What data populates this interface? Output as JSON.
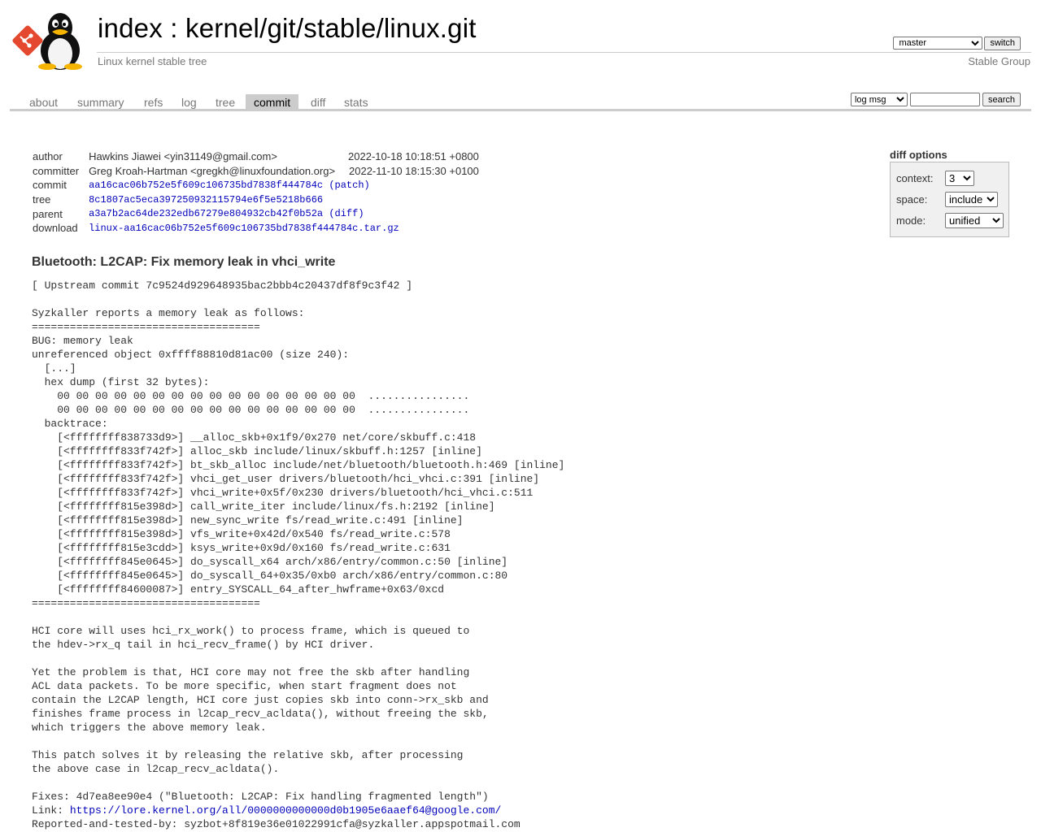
{
  "header": {
    "repo_index": "index",
    "repo_path": "kernel/git/stable/linux.git",
    "repo_path_separator": " : ",
    "description": "Linux kernel stable tree",
    "owner": "Stable Group",
    "branch_selected": "master",
    "switch_label": "switch"
  },
  "tabs": [
    {
      "label": "about",
      "active": false
    },
    {
      "label": "summary",
      "active": false
    },
    {
      "label": "refs",
      "active": false
    },
    {
      "label": "log",
      "active": false
    },
    {
      "label": "tree",
      "active": false
    },
    {
      "label": "commit",
      "active": true
    },
    {
      "label": "diff",
      "active": false
    },
    {
      "label": "stats",
      "active": false
    }
  ],
  "search": {
    "type_selected": "log msg",
    "query": "",
    "button_label": "search"
  },
  "commit_info": {
    "author_label": "author",
    "author": "Hawkins Jiawei <yin31149@gmail.com>",
    "author_date": "2022-10-18 10:18:51 +0800",
    "committer_label": "committer",
    "committer": "Greg Kroah-Hartman <gregkh@linuxfoundation.org>",
    "committer_date": "2022-11-10 18:15:30 +0100",
    "commit_label": "commit",
    "commit_sha": "aa16cac06b752e5f609c106735bd7838f444784c",
    "patch_link": "(patch)",
    "tree_label": "tree",
    "tree_sha": "8c1807ac5eca397250932115794e6f5e5218b666",
    "parent_label": "parent",
    "parent_sha": "a3a7b2ac64de232edb67279e804932cb42f0b52a",
    "diff_link": "(diff)",
    "download_label": "download",
    "download_link": "linux-aa16cac06b752e5f609c106735bd7838f444784c.tar.gz"
  },
  "diff_options": {
    "heading": "diff options",
    "context_label": "context:",
    "context_value": "3",
    "space_label": "space:",
    "space_value": "include",
    "mode_label": "mode:",
    "mode_value": "unified"
  },
  "message": {
    "subject": "Bluetooth: L2CAP: Fix memory leak in vhci_write",
    "body_before_link": "[ Upstream commit 7c9524d929648935bac2bbb4c20437df8f9c3f42 ]\n\nSyzkaller reports a memory leak as follows:\n====================================\nBUG: memory leak\nunreferenced object 0xffff88810d81ac00 (size 240):\n  [...]\n  hex dump (first 32 bytes):\n    00 00 00 00 00 00 00 00 00 00 00 00 00 00 00 00  ................\n    00 00 00 00 00 00 00 00 00 00 00 00 00 00 00 00  ................\n  backtrace:\n    [<ffffffff838733d9>] __alloc_skb+0x1f9/0x270 net/core/skbuff.c:418\n    [<ffffffff833f742f>] alloc_skb include/linux/skbuff.h:1257 [inline]\n    [<ffffffff833f742f>] bt_skb_alloc include/net/bluetooth/bluetooth.h:469 [inline]\n    [<ffffffff833f742f>] vhci_get_user drivers/bluetooth/hci_vhci.c:391 [inline]\n    [<ffffffff833f742f>] vhci_write+0x5f/0x230 drivers/bluetooth/hci_vhci.c:511\n    [<ffffffff815e398d>] call_write_iter include/linux/fs.h:2192 [inline]\n    [<ffffffff815e398d>] new_sync_write fs/read_write.c:491 [inline]\n    [<ffffffff815e398d>] vfs_write+0x42d/0x540 fs/read_write.c:578\n    [<ffffffff815e3cdd>] ksys_write+0x9d/0x160 fs/read_write.c:631\n    [<ffffffff845e0645>] do_syscall_x64 arch/x86/entry/common.c:50 [inline]\n    [<ffffffff845e0645>] do_syscall_64+0x35/0xb0 arch/x86/entry/common.c:80\n    [<ffffffff84600087>] entry_SYSCALL_64_after_hwframe+0x63/0xcd\n====================================\n\nHCI core will uses hci_rx_work() to process frame, which is queued to\nthe hdev->rx_q tail in hci_recv_frame() by HCI driver.\n\nYet the problem is that, HCI core may not free the skb after handling\nACL data packets. To be more specific, when start fragment does not\ncontain the L2CAP length, HCI core just copies skb into conn->rx_skb and\nfinishes frame process in l2cap_recv_acldata(), without freeing the skb,\nwhich triggers the above memory leak.\n\nThis patch solves it by releasing the relative skb, after processing\nthe above case in l2cap_recv_acldata().\n\nFixes: 4d7ea8ee90e4 (\"Bluetooth: L2CAP: Fix handling fragmented length\")\nLink: ",
    "link_url": "https://lore.kernel.org/all/0000000000000d0b1905e6aaef64@google.com/",
    "body_after_link": "\nReported-and-tested-by: syzbot+8f819e36e01022991cfa@syzkaller.appspotmail.com"
  }
}
